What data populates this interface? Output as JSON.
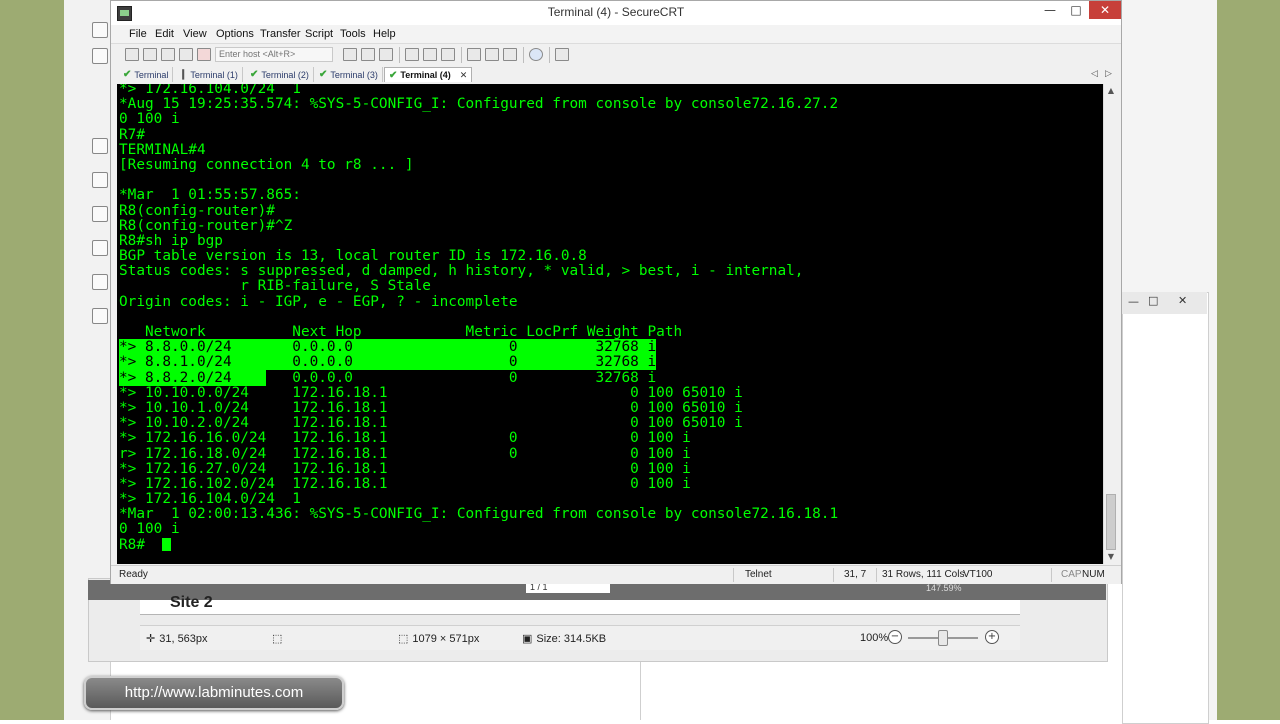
{
  "window": {
    "title": "Terminal (4) - SecureCRT",
    "controls": {
      "minimize": "—",
      "maximize": "□",
      "close": "✕"
    }
  },
  "menu": [
    "File",
    "Edit",
    "View",
    "Options",
    "Transfer",
    "Script",
    "Tools",
    "Help"
  ],
  "toolbar": {
    "host_placeholder": "Enter host <Alt+R>",
    "icons": [
      "connect-icon",
      "quick-connect-icon",
      "connect-tab-icon",
      "reconnect-icon",
      "disconnect-icon",
      "copy-icon",
      "paste-icon",
      "find-icon",
      "print-icon",
      "print-setup-icon",
      "session-options-icon",
      "global-options-icon",
      "keymap-icon",
      "sftp-icon",
      "help-icon",
      "screen-icon"
    ]
  },
  "tabs": [
    {
      "label": "Terminal",
      "active": false
    },
    {
      "label": "Terminal (1)",
      "active": false
    },
    {
      "label": "Terminal (2)",
      "active": false
    },
    {
      "label": "Terminal (3)",
      "active": false
    },
    {
      "label": "Terminal (4)",
      "active": true,
      "close": "✕"
    }
  ],
  "terminal": {
    "lines": [
      "*> 172.16.104.0/24  1",
      "*Aug 15 19:25:35.574: %SYS-5-CONFIG_I: Configured from console by console72.16.27.2",
      "0 100 i",
      "R7#",
      "TERMINAL#4",
      "[Resuming connection 4 to r8 ... ]",
      "",
      "*Mar  1 01:55:57.865:",
      "R8(config-router)#",
      "R8(config-router)#^Z",
      "R8#sh ip bgp",
      "BGP table version is 13, local router ID is 172.16.0.8",
      "Status codes: s suppressed, d damped, h history, * valid, > best, i - internal,",
      "              r RIB-failure, S Stale",
      "Origin codes: i - IGP, e - EGP, ? - incomplete",
      "",
      "   Network          Next Hop            Metric LocPrf Weight Path",
      "*> 8.8.0.0/24       0.0.0.0                  0         32768 i",
      "*> 8.8.1.0/24       0.0.0.0                  0         32768 i",
      "*> 8.8.2.0/24       0.0.0.0                  0         32768 i",
      "*> 10.10.0.0/24     172.16.18.1                            0 100 65010 i",
      "*> 10.10.1.0/24     172.16.18.1                            0 100 65010 i",
      "*> 10.10.2.0/24     172.16.18.1                            0 100 65010 i",
      "*> 172.16.16.0/24   172.16.18.1              0             0 100 i",
      "r> 172.16.18.0/24   172.16.18.1              0             0 100 i",
      "*> 172.16.27.0/24   172.16.18.1                            0 100 i",
      "*> 172.16.102.0/24  172.16.18.1                            0 100 i",
      "*> 172.16.104.0/24  1",
      "*Mar  1 02:00:13.436: %SYS-5-CONFIG_I: Configured from console by console72.16.18.1",
      "0 100 i",
      "R8#  "
    ]
  },
  "statusbar": {
    "ready": "Ready",
    "protocol": "Telnet",
    "position": "31,   7",
    "size": "31 Rows, 111 Cols",
    "emulation": "VT100",
    "cap": "CAP",
    "num": "NUM"
  },
  "bg_viewer": {
    "site_text": "Site 2",
    "page_indicator": "1 / 1",
    "zoom_top": "147.59%",
    "cursor_pos": "31, 563px",
    "selection_size": "1079 × 571px",
    "file_size": "Size: 314.5KB",
    "zoom": "100%"
  },
  "watermark": "http://www.labminutes.com",
  "colors": {
    "terminal_bg": "#000000",
    "terminal_fg": "#00ff00",
    "highlight": "#00ff00",
    "close_btn": "#c7403a"
  }
}
